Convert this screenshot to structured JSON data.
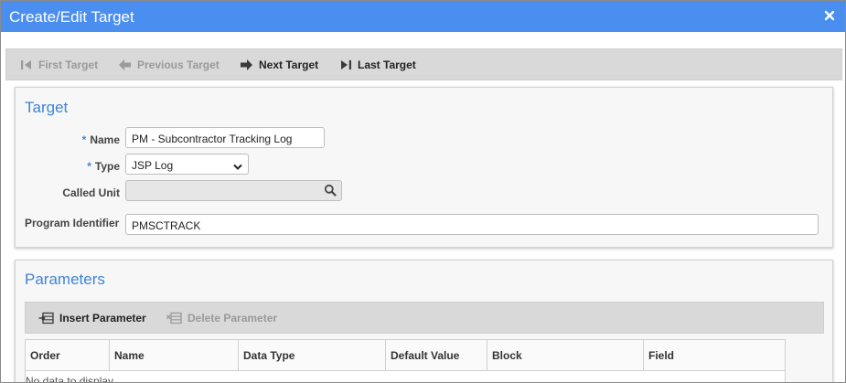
{
  "window": {
    "title": "Create/Edit Target",
    "close_icon": "close-icon"
  },
  "nav": {
    "first_label": "First Target",
    "previous_label": "Previous Target",
    "next_label": "Next Target",
    "last_label": "Last Target"
  },
  "target_section": {
    "title": "Target",
    "name_label": "Name",
    "name_value": "PM - Subcontractor Tracking Log",
    "type_label": "Type",
    "type_value": "JSP Log",
    "called_unit_label": "Called Unit",
    "called_unit_value": "",
    "program_identifier_label": "Program Identifier",
    "program_identifier_value": "PMSCTRACK",
    "required_marker": "*"
  },
  "parameters_section": {
    "title": "Parameters",
    "insert_label": "Insert Parameter",
    "delete_label": "Delete Parameter",
    "columns": [
      "Order",
      "Name",
      "Data Type",
      "Default Value",
      "Block",
      "Field"
    ],
    "empty_text": "No data to display."
  },
  "colors": {
    "titlebar": "#4a8ef0",
    "section_title": "#3f84d8",
    "disabled_text": "#9a9a9a"
  }
}
